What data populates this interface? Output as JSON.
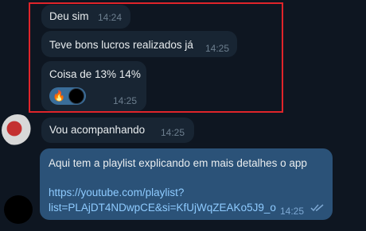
{
  "colors": {
    "background": "#0e1621",
    "incoming_bubble": "#182533",
    "outgoing_bubble": "#2b5278",
    "link": "#8ecbff",
    "highlight_border": "#e0242a"
  },
  "messages": [
    {
      "text": "Deu sim",
      "time": "14:24"
    },
    {
      "text": "Teve bons lucros realizados já",
      "time": "14:25"
    },
    {
      "text": "Coisa de 13% 14%",
      "time": "14:25",
      "reaction_emoji": "🔥",
      "reaction_avatar_icon": "avatar-icon"
    },
    {
      "text": "Vou acompanhando",
      "time": "14:25"
    }
  ],
  "outgoing": {
    "text": "Aqui tem a playlist explicando em mais detalhes o app",
    "link_line1": "https://youtube.com/playlist?",
    "link_line2": "list=PLAjDT4NDwpCE&si=KfUjWqZEAKo5J9_o",
    "time": "14:25",
    "status_icon": "double-check-icon"
  }
}
